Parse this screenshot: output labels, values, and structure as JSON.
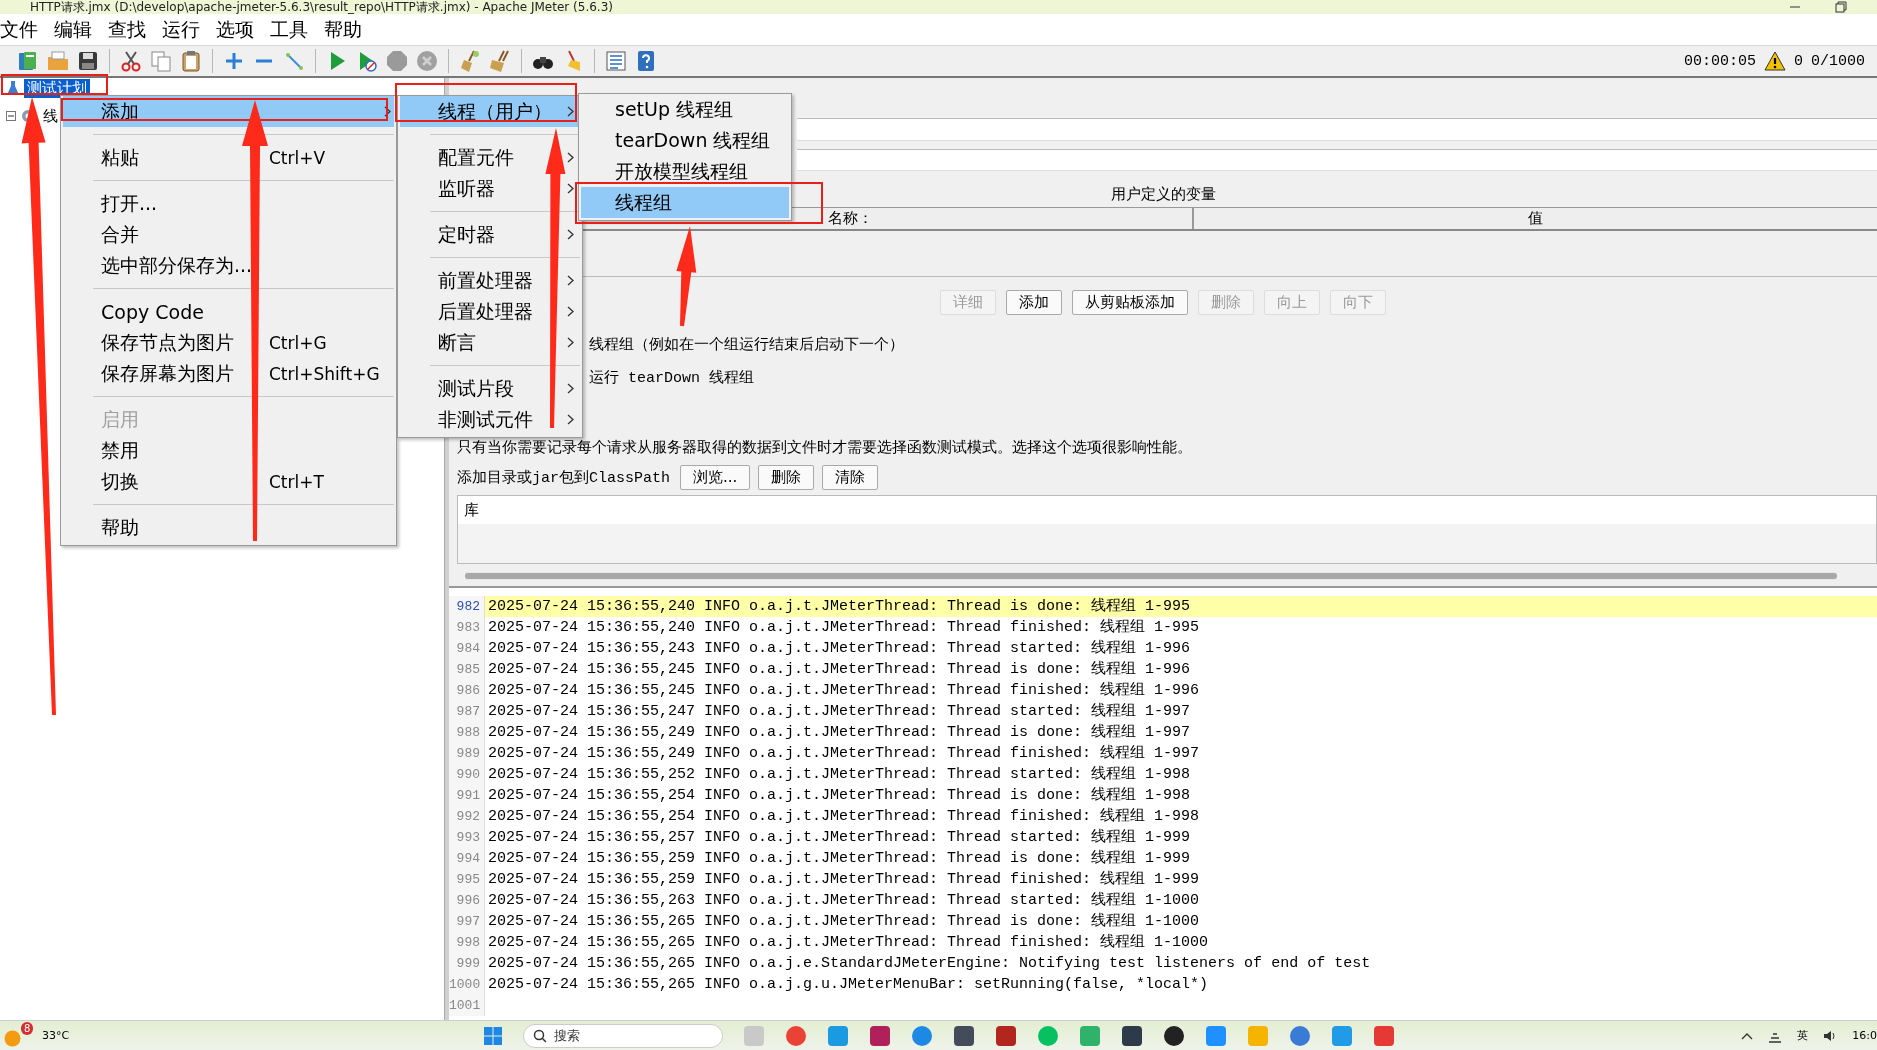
{
  "window": {
    "title": "HTTP请求.jmx (D:\\develop\\apache-jmeter-5.6.3\\result_repo\\HTTP请求.jmx) - Apache JMeter (5.6.3)"
  },
  "menu_bar": [
    {
      "label": "文件"
    },
    {
      "label": "编辑"
    },
    {
      "label": "查找"
    },
    {
      "label": "运行"
    },
    {
      "label": "选项"
    },
    {
      "label": "工具"
    },
    {
      "label": "帮助"
    }
  ],
  "toolbar": {
    "elapsed": "00:00:05",
    "warnings": "0",
    "threads": "0/1000"
  },
  "tree": [
    {
      "label": "测试计划",
      "selected": true
    },
    {
      "label": "线",
      "selected": false
    }
  ],
  "context_menu": [
    {
      "kind": "item",
      "label": "添加",
      "submenu": true,
      "selected": true,
      "disabled": false
    },
    {
      "kind": "separator"
    },
    {
      "kind": "item",
      "label": "粘贴",
      "shortcut": "Ctrl+V",
      "submenu": false,
      "selected": false,
      "disabled": false
    },
    {
      "kind": "separator"
    },
    {
      "kind": "item",
      "label": "打开...",
      "submenu": false,
      "selected": false,
      "disabled": false
    },
    {
      "kind": "item",
      "label": "合并",
      "submenu": false,
      "selected": false,
      "disabled": false
    },
    {
      "kind": "item",
      "label": "选中部分保存为...",
      "submenu": false,
      "selected": false,
      "disabled": false
    },
    {
      "kind": "separator"
    },
    {
      "kind": "item",
      "label": "Copy Code",
      "submenu": false,
      "selected": false,
      "disabled": false
    },
    {
      "kind": "item",
      "label": "保存节点为图片",
      "shortcut": "Ctrl+G",
      "submenu": false,
      "selected": false,
      "disabled": false
    },
    {
      "kind": "item",
      "label": "保存屏幕为图片",
      "shortcut": "Ctrl+Shift+G",
      "submenu": false,
      "selected": false,
      "disabled": false
    },
    {
      "kind": "separator"
    },
    {
      "kind": "item",
      "label": "启用",
      "submenu": false,
      "selected": false,
      "disabled": true
    },
    {
      "kind": "item",
      "label": "禁用",
      "submenu": false,
      "selected": false,
      "disabled": false
    },
    {
      "kind": "item",
      "label": "切换",
      "shortcut": "Ctrl+T",
      "submenu": false,
      "selected": false,
      "disabled": false
    },
    {
      "kind": "separator"
    },
    {
      "kind": "item",
      "label": "帮助",
      "submenu": false,
      "selected": false,
      "disabled": false
    }
  ],
  "add_submenu": [
    {
      "kind": "item",
      "label": "线程（用户）",
      "submenu": true,
      "selected": true,
      "disabled": false
    },
    {
      "kind": "separator"
    },
    {
      "kind": "item",
      "label": "配置元件",
      "submenu": true,
      "selected": false,
      "disabled": false
    },
    {
      "kind": "item",
      "label": "监听器",
      "submenu": true,
      "selected": false,
      "disabled": false
    },
    {
      "kind": "separator"
    },
    {
      "kind": "item",
      "label": "定时器",
      "submenu": true,
      "selected": false,
      "disabled": false
    },
    {
      "kind": "separator"
    },
    {
      "kind": "item",
      "label": "前置处理器",
      "submenu": true,
      "selected": false,
      "disabled": false
    },
    {
      "kind": "item",
      "label": "后置处理器",
      "submenu": true,
      "selected": false,
      "disabled": false
    },
    {
      "kind": "item",
      "label": "断言",
      "submenu": true,
      "selected": false,
      "disabled": false
    },
    {
      "kind": "separator"
    },
    {
      "kind": "item",
      "label": "测试片段",
      "submenu": true,
      "selected": false,
      "disabled": false
    },
    {
      "kind": "item",
      "label": "非测试元件",
      "submenu": true,
      "selected": false,
      "disabled": false
    }
  ],
  "thread_submenu": [
    {
      "kind": "item",
      "label": "setUp 线程组",
      "submenu": false,
      "selected": false,
      "disabled": false
    },
    {
      "kind": "item",
      "label": "tearDown 线程组",
      "submenu": false,
      "selected": false,
      "disabled": false
    },
    {
      "kind": "item",
      "label": "开放模型线程组",
      "submenu": false,
      "selected": false,
      "disabled": false
    },
    {
      "kind": "item",
      "label": "线程组",
      "submenu": false,
      "selected": true,
      "disabled": false
    }
  ],
  "test_plan": {
    "variables_title": "用户定义的变量",
    "columns": [
      "名称：",
      "值"
    ],
    "table_buttons": [
      {
        "label": "详细",
        "disabled": true
      },
      {
        "label": "添加",
        "disabled": false
      },
      {
        "label": "从剪贴板添加",
        "disabled": false
      },
      {
        "label": "删除",
        "disabled": true
      },
      {
        "label": "向上",
        "disabled": true
      },
      {
        "label": "向下",
        "disabled": true
      }
    ],
    "notes": [
      "线程组（例如在一个组运行结束后启动下一个）",
      "运行 tearDown 线程组"
    ],
    "functional_mode_hint": "只有当你需要记录每个请求从服务器取得的数据到文件时才需要选择函数测试模式。选择这个选项很影响性能。",
    "classpath_label": "添加目录或jar包到ClassPath",
    "classpath_buttons": [
      "浏览...",
      "删除",
      "清除"
    ],
    "library_column": "库"
  },
  "log": [
    {
      "number": "982",
      "text": "2025-07-24 15:36:55,240 INFO o.a.j.t.JMeterThread: Thread is done: 线程组 1-995",
      "selected": true
    },
    {
      "number": "983",
      "text": "2025-07-24 15:36:55,240 INFO o.a.j.t.JMeterThread: Thread finished: 线程组 1-995",
      "selected": false
    },
    {
      "number": "984",
      "text": "2025-07-24 15:36:55,243 INFO o.a.j.t.JMeterThread: Thread started: 线程组 1-996",
      "selected": false
    },
    {
      "number": "985",
      "text": "2025-07-24 15:36:55,245 INFO o.a.j.t.JMeterThread: Thread is done: 线程组 1-996",
      "selected": false
    },
    {
      "number": "986",
      "text": "2025-07-24 15:36:55,245 INFO o.a.j.t.JMeterThread: Thread finished: 线程组 1-996",
      "selected": false
    },
    {
      "number": "987",
      "text": "2025-07-24 15:36:55,247 INFO o.a.j.t.JMeterThread: Thread started: 线程组 1-997",
      "selected": false
    },
    {
      "number": "988",
      "text": "2025-07-24 15:36:55,249 INFO o.a.j.t.JMeterThread: Thread is done: 线程组 1-997",
      "selected": false
    },
    {
      "number": "989",
      "text": "2025-07-24 15:36:55,249 INFO o.a.j.t.JMeterThread: Thread finished: 线程组 1-997",
      "selected": false
    },
    {
      "number": "990",
      "text": "2025-07-24 15:36:55,252 INFO o.a.j.t.JMeterThread: Thread started: 线程组 1-998",
      "selected": false
    },
    {
      "number": "991",
      "text": "2025-07-24 15:36:55,254 INFO o.a.j.t.JMeterThread: Thread is done: 线程组 1-998",
      "selected": false
    },
    {
      "number": "992",
      "text": "2025-07-24 15:36:55,254 INFO o.a.j.t.JMeterThread: Thread finished: 线程组 1-998",
      "selected": false
    },
    {
      "number": "993",
      "text": "2025-07-24 15:36:55,257 INFO o.a.j.t.JMeterThread: Thread started: 线程组 1-999",
      "selected": false
    },
    {
      "number": "994",
      "text": "2025-07-24 15:36:55,259 INFO o.a.j.t.JMeterThread: Thread is done: 线程组 1-999",
      "selected": false
    },
    {
      "number": "995",
      "text": "2025-07-24 15:36:55,259 INFO o.a.j.t.JMeterThread: Thread finished: 线程组 1-999",
      "selected": false
    },
    {
      "number": "996",
      "text": "2025-07-24 15:36:55,263 INFO o.a.j.t.JMeterThread: Thread started: 线程组 1-1000",
      "selected": false
    },
    {
      "number": "997",
      "text": "2025-07-24 15:36:55,265 INFO o.a.j.t.JMeterThread: Thread is done: 线程组 1-1000",
      "selected": false
    },
    {
      "number": "998",
      "text": "2025-07-24 15:36:55,265 INFO o.a.j.t.JMeterThread: Thread finished: 线程组 1-1000",
      "selected": false
    },
    {
      "number": "999",
      "text": "2025-07-24 15:36:55,265 INFO o.a.j.e.StandardJMeterEngine: Notifying test listeners of end of test",
      "selected": false
    },
    {
      "number": "1000",
      "text": "2025-07-24 15:36:55,265 INFO o.a.j.g.u.JMeterMenuBar: setRunning(false, *local*)",
      "selected": false
    },
    {
      "number": "1001",
      "selected": false
    }
  ],
  "taskbar": {
    "weather_badge": "8",
    "temperature": "33°C",
    "search_placeholder": "搜索",
    "input_language": "英",
    "clock": "16:0"
  }
}
